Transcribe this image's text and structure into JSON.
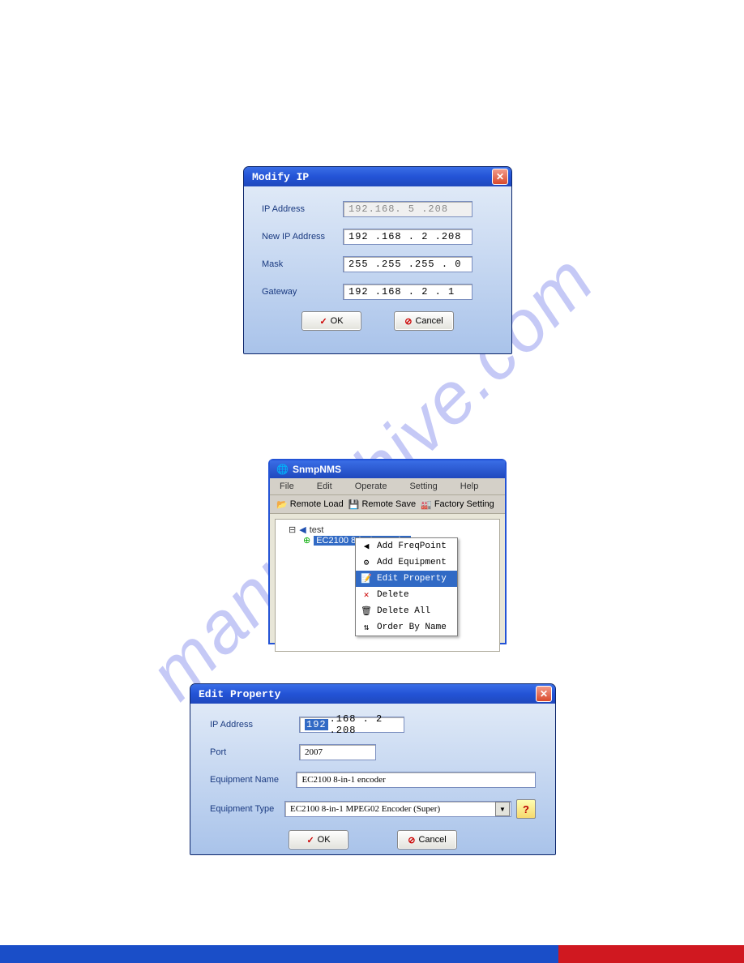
{
  "watermark": "manualshive.com",
  "win1": {
    "title": "Modify IP",
    "fields": {
      "ip_label": "IP Address",
      "ip_value": "192.168. 5 .208",
      "new_ip_label": "New IP Address",
      "new_ip_value": "192 .168 . 2  .208",
      "mask_label": "Mask",
      "mask_value": "255 .255 .255 . 0",
      "gw_label": "Gateway",
      "gw_value": "192 .168 .  2  .  1"
    },
    "ok": "OK",
    "cancel": "Cancel"
  },
  "app": {
    "title": "SnmpNMS",
    "menus": [
      "File",
      "Edit",
      "Operate",
      "Setting",
      "Help"
    ],
    "tools": [
      "Remote Load",
      "Remote Save",
      "Factory Setting"
    ],
    "tree_root": "test",
    "tree_child": "EC2100 8-in-1 encoder",
    "ctx": [
      "Add FreqPoint",
      "Add Equipment",
      "Edit Property",
      "Delete",
      "Delete All",
      "Order By Name"
    ]
  },
  "win2": {
    "title": "Edit Property",
    "ip_label": "IP Address",
    "ip_sel": "192",
    "ip_rest": ".168 .  2  .208",
    "port_label": "Port",
    "port": "2007",
    "name_label": "Equipment Name",
    "name": "EC2100 8-in-1 encoder",
    "type_label": "Equipment Type",
    "type": "EC2100 8-in-1 MPEG02 Encoder (Super)",
    "help": "?",
    "ok": "OK",
    "cancel": "Cancel"
  }
}
